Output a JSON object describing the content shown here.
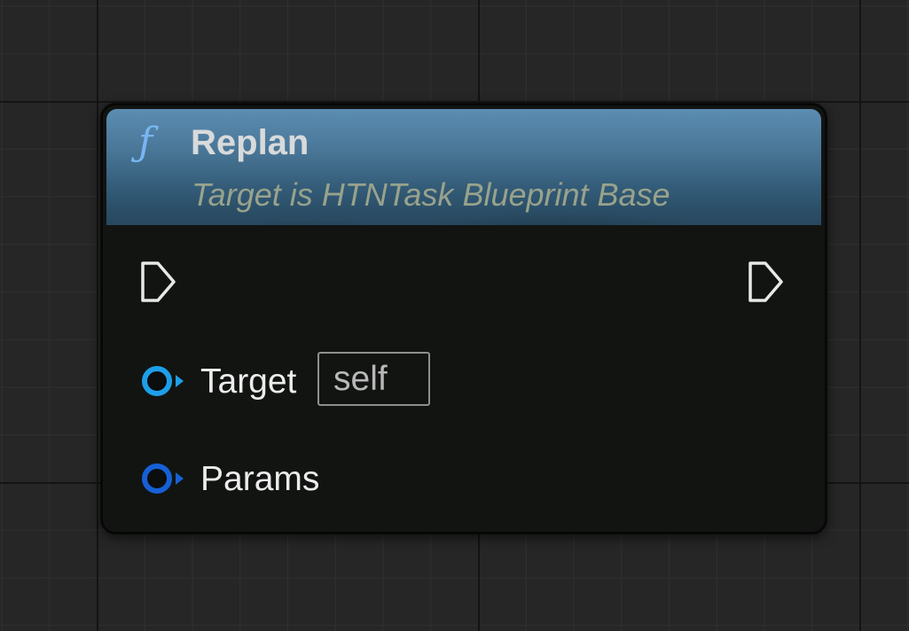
{
  "node": {
    "icon": "function-icon",
    "icon_glyph": "ƒ",
    "title": "Replan",
    "subtitle": "Target is HTNTask Blueprint Base",
    "header_color": "#4a7798"
  },
  "pins": {
    "exec_in_icon": "exec-arrow-icon",
    "exec_out_icon": "exec-arrow-icon",
    "target": {
      "label": "Target",
      "default_value": "self",
      "color": "#1d9fe8"
    },
    "params": {
      "label": "Params",
      "color": "#1660d6"
    }
  }
}
